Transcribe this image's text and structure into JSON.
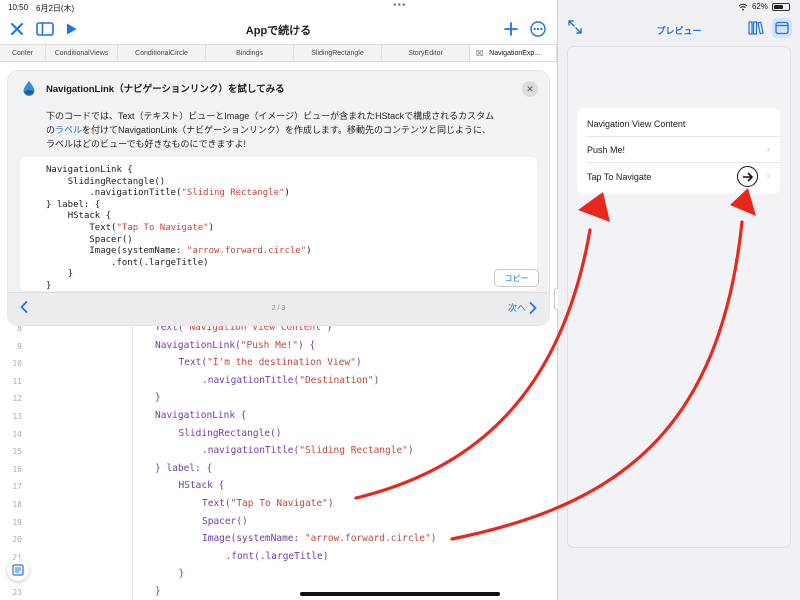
{
  "status": {
    "time": "10:50",
    "date": "6月2日(木)",
    "battery": "62%",
    "battery_level": 0.62
  },
  "nav": {
    "title": "Appで続ける"
  },
  "tabs": [
    {
      "label": "Conter"
    },
    {
      "label": "ConditionalViews"
    },
    {
      "label": "ConditionalCircle"
    },
    {
      "label": "Bindings"
    },
    {
      "label": "SlidingRectangle"
    },
    {
      "label": "StoryEditor"
    },
    {
      "label": "NavigationExp..."
    }
  ],
  "card": {
    "title": "NavigationLink（ナビゲーションリンク）を試してみる",
    "desc_line1": "下のコードでは、Text（テキスト）ビューとImage（イメージ）ビューが含まれたHStackで構成されるカスタム",
    "desc_line2_pre": "の",
    "desc_line2_link": "ラベル",
    "desc_line2_post": "を付けてNavigationLink（ナビゲーションリンク）を作成します。移動先のコンテンツと同じように、",
    "desc_line3": "ラベルはどのビューでも好きなものにできますよ!",
    "snippet": [
      {
        "indent": "",
        "parts": [
          {
            "t": "NavigationLink {",
            "c": "plain"
          }
        ]
      },
      {
        "indent": "    ",
        "parts": [
          {
            "t": "SlidingRectangle()",
            "c": "plain"
          }
        ]
      },
      {
        "indent": "        ",
        "parts": [
          {
            "t": ".navigationTitle(",
            "c": "plain"
          },
          {
            "t": "\"Sliding Rectangle\"",
            "c": "str"
          },
          {
            "t": ")",
            "c": "plain"
          }
        ]
      },
      {
        "indent": "",
        "parts": [
          {
            "t": "} label: {",
            "c": "plain"
          }
        ]
      },
      {
        "indent": "    ",
        "parts": [
          {
            "t": "HStack {",
            "c": "plain"
          }
        ]
      },
      {
        "indent": "        ",
        "parts": [
          {
            "t": "Text(",
            "c": "plain"
          },
          {
            "t": "\"Tap To Navigate\"",
            "c": "str"
          },
          {
            "t": ")",
            "c": "plain"
          }
        ]
      },
      {
        "indent": "        ",
        "parts": [
          {
            "t": "Spacer()",
            "c": "plain"
          }
        ]
      },
      {
        "indent": "        ",
        "parts": [
          {
            "t": "Image(systemName: ",
            "c": "plain"
          },
          {
            "t": "\"arrow.forward.circle\"",
            "c": "str"
          },
          {
            "t": ")",
            "c": "plain"
          }
        ]
      },
      {
        "indent": "            ",
        "parts": [
          {
            "t": ".font(.largeTitle)",
            "c": "plain"
          }
        ]
      },
      {
        "indent": "    ",
        "parts": [
          {
            "t": "}",
            "c": "plain"
          }
        ]
      },
      {
        "indent": "",
        "parts": [
          {
            "t": "}",
            "c": "plain"
          }
        ]
      }
    ],
    "copy_label": "コピー",
    "page": "2 / 3",
    "next_label": "次へ"
  },
  "editor": {
    "lines": [
      {
        "n": "8",
        "indent": 0,
        "parts": [
          {
            "t": "Text(",
            "c": "fn"
          },
          {
            "t": "\"Navigation View Content\"",
            "c": "str"
          },
          {
            "t": ")",
            "c": "fn"
          }
        ]
      },
      {
        "n": "9",
        "indent": 0,
        "parts": [
          {
            "t": "NavigationLink(",
            "c": "fn"
          },
          {
            "t": "\"Push Me!\"",
            "c": "str"
          },
          {
            "t": ") {",
            "c": "fn"
          }
        ]
      },
      {
        "n": "10",
        "indent": 1,
        "parts": [
          {
            "t": "Text(",
            "c": "fn"
          },
          {
            "t": "\"I'm the destination View\"",
            "c": "str"
          },
          {
            "t": ")",
            "c": "fn"
          }
        ]
      },
      {
        "n": "11",
        "indent": 2,
        "parts": [
          {
            "t": ".navigationTitle(",
            "c": "fn"
          },
          {
            "t": "\"Destination\"",
            "c": "str"
          },
          {
            "t": ")",
            "c": "fn"
          }
        ]
      },
      {
        "n": "12",
        "indent": 0,
        "parts": [
          {
            "t": "}",
            "c": "fn"
          }
        ]
      },
      {
        "n": "13",
        "indent": 0,
        "parts": [
          {
            "t": "NavigationLink {",
            "c": "fn"
          }
        ]
      },
      {
        "n": "14",
        "indent": 1,
        "parts": [
          {
            "t": "SlidingRectangle()",
            "c": "fn"
          }
        ]
      },
      {
        "n": "15",
        "indent": 2,
        "parts": [
          {
            "t": ".navigationTitle(",
            "c": "fn"
          },
          {
            "t": "\"Sliding Rectangle\"",
            "c": "str"
          },
          {
            "t": ")",
            "c": "fn"
          }
        ]
      },
      {
        "n": "16",
        "indent": 0,
        "parts": [
          {
            "t": "} label: {",
            "c": "fn"
          }
        ]
      },
      {
        "n": "17",
        "indent": 1,
        "parts": [
          {
            "t": "HStack {",
            "c": "fn"
          }
        ]
      },
      {
        "n": "18",
        "indent": 2,
        "parts": [
          {
            "t": "Text(",
            "c": "fn"
          },
          {
            "t": "\"Tap To Navigate\"",
            "c": "str"
          },
          {
            "t": ")",
            "c": "fn"
          }
        ]
      },
      {
        "n": "19",
        "indent": 2,
        "parts": [
          {
            "t": "Spacer()",
            "c": "fn"
          }
        ]
      },
      {
        "n": "20",
        "indent": 2,
        "parts": [
          {
            "t": "Image(systemName: ",
            "c": "fn"
          },
          {
            "t": "\"arrow.forward.circle\"",
            "c": "str"
          },
          {
            "t": ")",
            "c": "fn"
          }
        ]
      },
      {
        "n": "21",
        "indent": 3,
        "parts": [
          {
            "t": ".font(.largeTitle)",
            "c": "fn"
          }
        ]
      },
      {
        "n": "22",
        "indent": 1,
        "parts": [
          {
            "t": "}",
            "c": "fn"
          }
        ]
      },
      {
        "n": "23",
        "indent": 0,
        "parts": [
          {
            "t": "}",
            "c": "fn"
          }
        ]
      }
    ]
  },
  "preview": {
    "title": "プレビュー",
    "rows": [
      {
        "label": "Navigation View Content",
        "chevron": false
      },
      {
        "label": "Push Me!",
        "chevron": true
      },
      {
        "label": "Tap To Navigate",
        "chevron": true,
        "icon": "arrow-forward-circle-icon"
      }
    ]
  },
  "colors": {
    "accent": "#1a73e8",
    "annotation": "#e8281c",
    "string": "#c2463b",
    "code": "#6e3fa8"
  }
}
